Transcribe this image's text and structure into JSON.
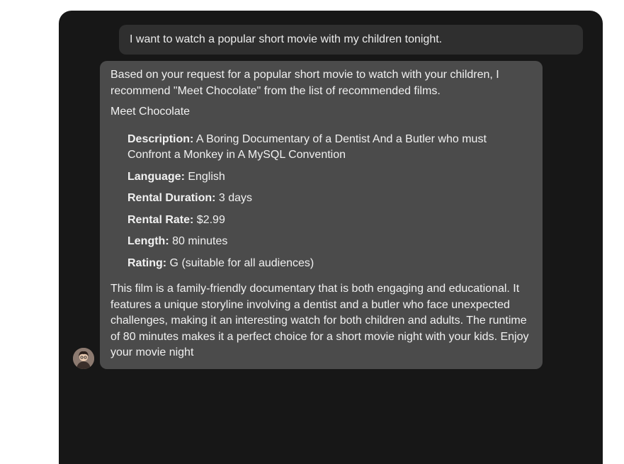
{
  "user_message": "I want to watch a popular short movie with my children tonight.",
  "assistant_message": {
    "intro": "Based on your request for a popular short movie to watch with your children, I recommend \"Meet Chocolate\" from the list of recommended films.",
    "film_title": "Meet Chocolate",
    "details": [
      {
        "label": "Description",
        "value": " A Boring Documentary of a Dentist And a Butler who must Confront a Monkey in A MySQL Convention"
      },
      {
        "label": "Language",
        "value": " English"
      },
      {
        "label": "Rental Duration",
        "value": " 3 days"
      },
      {
        "label": "Rental Rate",
        "value": " $2.99"
      },
      {
        "label": "Length",
        "value": " 80 minutes"
      },
      {
        "label": "Rating",
        "value": " G (suitable for all audiences)"
      }
    ],
    "summary": "This film is a family-friendly documentary that is both engaging and educational. It features a unique storyline involving a dentist and a butler who face unexpected challenges, making it an interesting watch for both children and adults. The runtime of 80 minutes makes it a perfect choice for a short movie night with your kids. Enjoy your movie night"
  },
  "avatar": {
    "icon": "assistant-avatar-icon"
  },
  "colors": {
    "panel_bg": "#171717",
    "user_bubble_bg": "#2f2f2f",
    "assistant_bubble_bg": "#4b4b4b",
    "text": "#ececec"
  }
}
